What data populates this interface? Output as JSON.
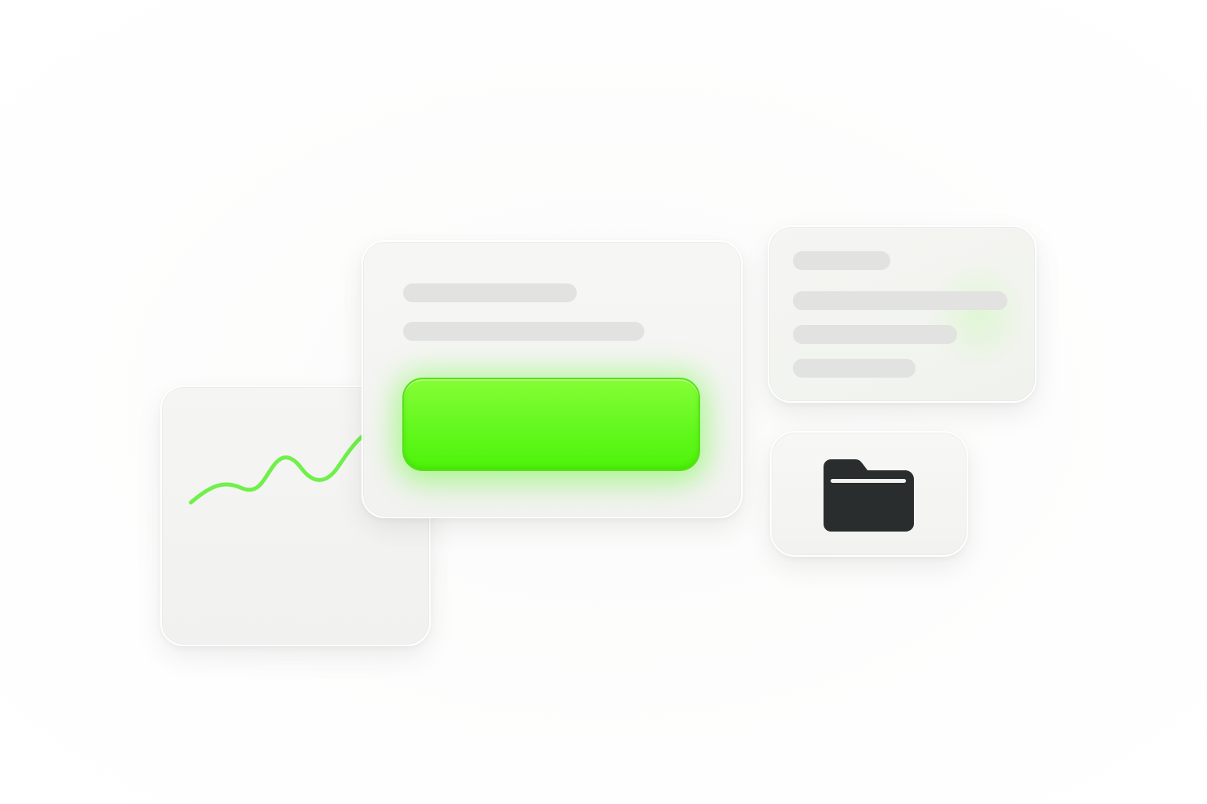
{
  "theme": {
    "background": "#fdfdfc",
    "card_surface": "#f4f4f2",
    "placeholder_bar": "#e2e2e0",
    "accent_green": "#63f81e",
    "chart_line": "#6ff04a",
    "icon_dark": "#2a2d2e"
  },
  "chart_card": {
    "icon": "sparkline-chart",
    "line_color": "#6ff04a"
  },
  "main_card": {
    "primary_button_label": ""
  },
  "folder_card": {
    "icon": "folder-icon",
    "icon_color": "#2a2d2e"
  }
}
